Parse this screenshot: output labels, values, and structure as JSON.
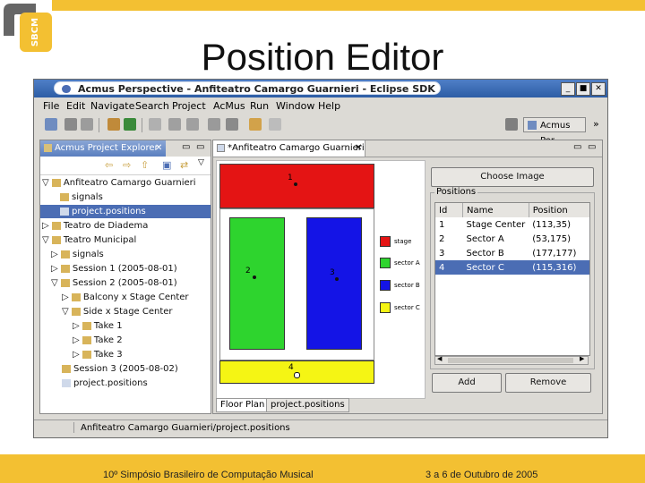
{
  "slide": {
    "logo_text": "SBCM",
    "title": "Position Editor",
    "footer_left": "10º Simpósio Brasileiro de Computação Musical",
    "footer_right": "3 a 6 de Outubro de 2005"
  },
  "window": {
    "title": "Acmus Perspective - Anfiteatro Camargo Guarnieri - Eclipse SDK",
    "controls": [
      "_",
      "■",
      "✕"
    ],
    "menu": [
      "File",
      "Edit",
      "Navigate",
      "Search",
      "Project",
      "AcMus",
      "Run",
      "Window",
      "Help"
    ],
    "perspective_label": "Acmus Per",
    "status_text": "Anfiteatro Camargo Guarnieri/project.positions"
  },
  "explorer": {
    "tab_label": "Acmus Project Explorer",
    "items": [
      {
        "label": "Anfiteatro Camargo Guarnieri",
        "toggle": "▽"
      },
      {
        "label": "signals",
        "toggle": ""
      },
      {
        "label": "project.positions",
        "toggle": ""
      },
      {
        "label": "Teatro de Diadema",
        "toggle": "▷"
      },
      {
        "label": "Teatro Municipal",
        "toggle": "▽"
      },
      {
        "label": "signals",
        "toggle": "▷"
      },
      {
        "label": "Session 1 (2005-08-01)",
        "toggle": "▷"
      },
      {
        "label": "Session 2 (2005-08-01)",
        "toggle": "▽"
      },
      {
        "label": "Balcony x Stage Center",
        "toggle": "▷"
      },
      {
        "label": "Side x Stage Center",
        "toggle": "▽"
      },
      {
        "label": "Take 1",
        "toggle": "▷"
      },
      {
        "label": "Take 2",
        "toggle": "▷"
      },
      {
        "label": "Take 3",
        "toggle": "▷"
      },
      {
        "label": "Session 3 (2005-08-02)",
        "toggle": ""
      },
      {
        "label": "project.positions",
        "toggle": ""
      }
    ]
  },
  "editor": {
    "tab_label": "*Anfiteatro Camargo Guarnieri",
    "floor_markers": [
      "1",
      "2",
      "3",
      "4"
    ],
    "legend": [
      {
        "label": "stage",
        "color": "#e41414"
      },
      {
        "label": "sector A",
        "color": "#2ed42e"
      },
      {
        "label": "sector B",
        "color": "#1414e6"
      },
      {
        "label": "sector C",
        "color": "#f5f514"
      }
    ],
    "bottom_tabs": [
      "Floor Plan",
      "project.positions"
    ],
    "choose_image_label": "Choose Image",
    "positions_group_label": "Positions",
    "columns": [
      "Id",
      "Name",
      "Position"
    ],
    "rows": [
      {
        "id": "1",
        "name": "Stage Center",
        "position": "(113,35)"
      },
      {
        "id": "2",
        "name": "Sector A",
        "position": "(53,175)"
      },
      {
        "id": "3",
        "name": "Sector B",
        "position": "(177,177)"
      },
      {
        "id": "4",
        "name": "Sector C",
        "position": "(115,316)"
      }
    ],
    "add_label": "Add",
    "remove_label": "Remove"
  }
}
